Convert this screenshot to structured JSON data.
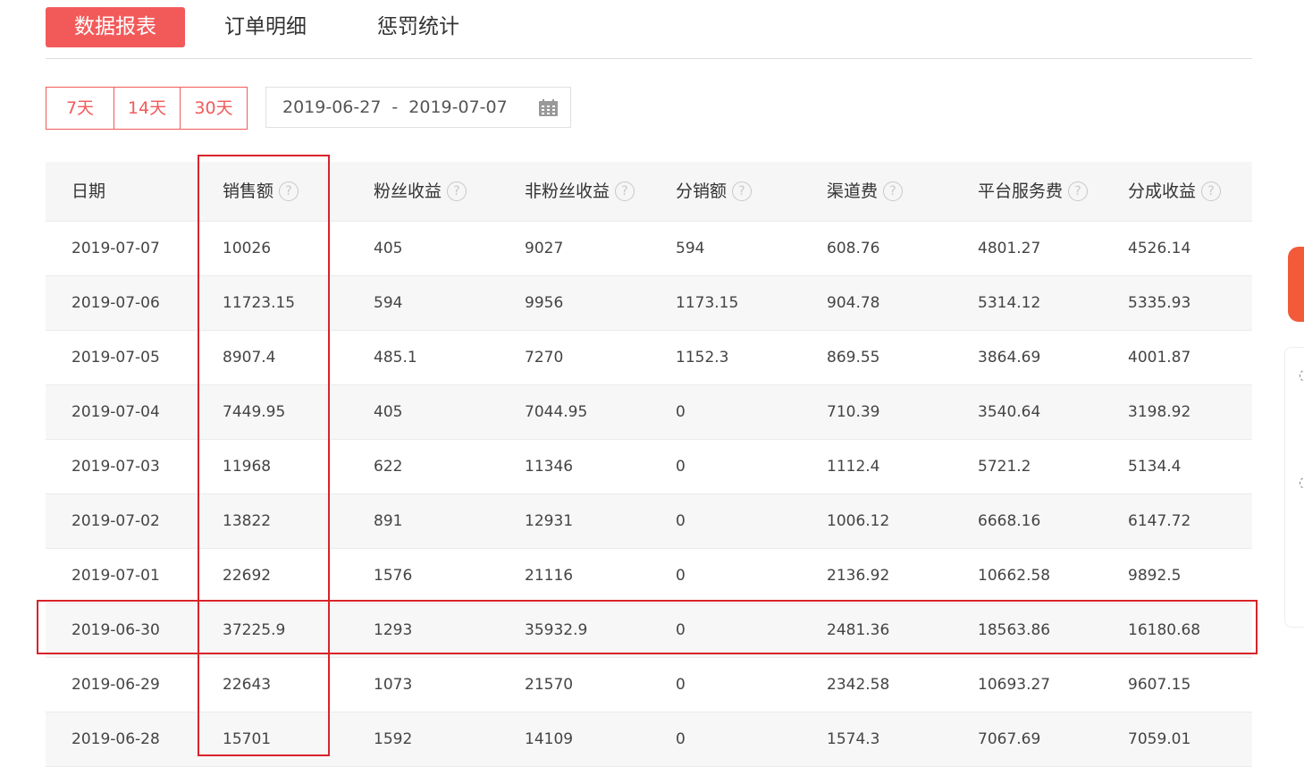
{
  "tabs": [
    {
      "label": "数据报表",
      "active": true
    },
    {
      "label": "订单明细",
      "active": false
    },
    {
      "label": "惩罚统计",
      "active": false
    }
  ],
  "range_buttons": [
    "7天",
    "14天",
    "30天"
  ],
  "date_range": {
    "start": "2019-06-27",
    "separator": "-",
    "end": "2019-07-07"
  },
  "table": {
    "headers": [
      {
        "label": "日期",
        "help": false
      },
      {
        "label": "销售额",
        "help": true
      },
      {
        "label": "粉丝收益",
        "help": true
      },
      {
        "label": "非粉丝收益",
        "help": true
      },
      {
        "label": "分销额",
        "help": true
      },
      {
        "label": "渠道费",
        "help": true
      },
      {
        "label": "平台服务费",
        "help": true
      },
      {
        "label": "分成收益",
        "help": true
      }
    ],
    "help_glyph": "?",
    "rows": [
      [
        "2019-07-07",
        "10026",
        "405",
        "9027",
        "594",
        "608.76",
        "4801.27",
        "4526.14"
      ],
      [
        "2019-07-06",
        "11723.15",
        "594",
        "9956",
        "1173.15",
        "904.78",
        "5314.12",
        "5335.93"
      ],
      [
        "2019-07-05",
        "8907.4",
        "485.1",
        "7270",
        "1152.3",
        "869.55",
        "3864.69",
        "4001.87"
      ],
      [
        "2019-07-04",
        "7449.95",
        "405",
        "7044.95",
        "0",
        "710.39",
        "3540.64",
        "3198.92"
      ],
      [
        "2019-07-03",
        "11968",
        "622",
        "11346",
        "0",
        "1112.4",
        "5721.2",
        "5134.4"
      ],
      [
        "2019-07-02",
        "13822",
        "891",
        "12931",
        "0",
        "1006.12",
        "6668.16",
        "6147.72"
      ],
      [
        "2019-07-01",
        "22692",
        "1576",
        "21116",
        "0",
        "2136.92",
        "10662.58",
        "9892.5"
      ],
      [
        "2019-06-30",
        "37225.9",
        "1293",
        "35932.9",
        "0",
        "2481.36",
        "18563.86",
        "16180.68"
      ],
      [
        "2019-06-29",
        "22643",
        "1073",
        "21570",
        "0",
        "2342.58",
        "10693.27",
        "9607.15"
      ],
      [
        "2019-06-28",
        "15701",
        "1592",
        "14109",
        "0",
        "1574.3",
        "7067.69",
        "7059.01"
      ]
    ]
  },
  "colors": {
    "accent": "#f25a5a",
    "highlight": "#d8232a"
  },
  "icons": {
    "date": "calendar-icon",
    "help": "help-circle-icon"
  }
}
